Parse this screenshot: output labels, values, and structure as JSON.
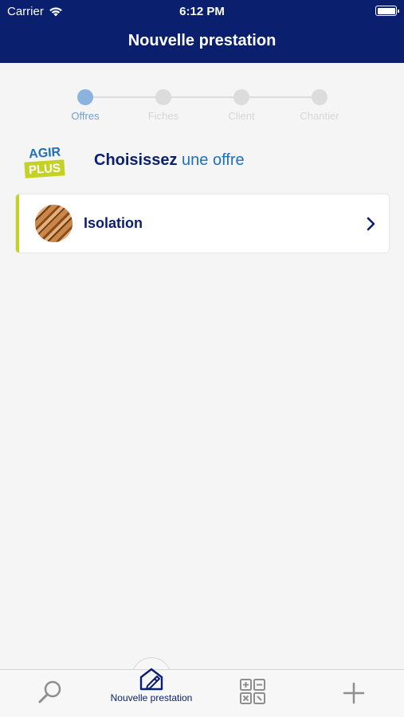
{
  "status_bar": {
    "carrier": "Carrier",
    "time": "6:12 PM",
    "icons": [
      "wifi-icon",
      "battery-icon"
    ]
  },
  "navigation": {
    "title": "Nouvelle prestation"
  },
  "stepper": {
    "steps": [
      {
        "label": "Offres",
        "active": true
      },
      {
        "label": "Fiches",
        "active": false
      },
      {
        "label": "Client",
        "active": false
      },
      {
        "label": "Chantier",
        "active": false
      }
    ]
  },
  "logo": {
    "line1": "AGIR",
    "line2": "PLUS"
  },
  "heading": {
    "prefix": "Choisissez",
    "accent": "une offre"
  },
  "offers": [
    {
      "label": "Isolation",
      "icon": "chevron-right-icon"
    }
  ],
  "tabbar": {
    "tabs": [
      {
        "icon": "search-icon",
        "label": ""
      },
      {
        "icon": "new-service-icon",
        "label": "Nouvelle prestation",
        "selected": true
      },
      {
        "icon": "calculator-icon",
        "label": ""
      },
      {
        "icon": "plus-icon",
        "label": ""
      }
    ]
  },
  "colors": {
    "brand_navy": "#0a1f6e",
    "accent_blue": "#1f6fbf",
    "offer_border": "#c5d225",
    "step_active": "#8cb2de"
  }
}
